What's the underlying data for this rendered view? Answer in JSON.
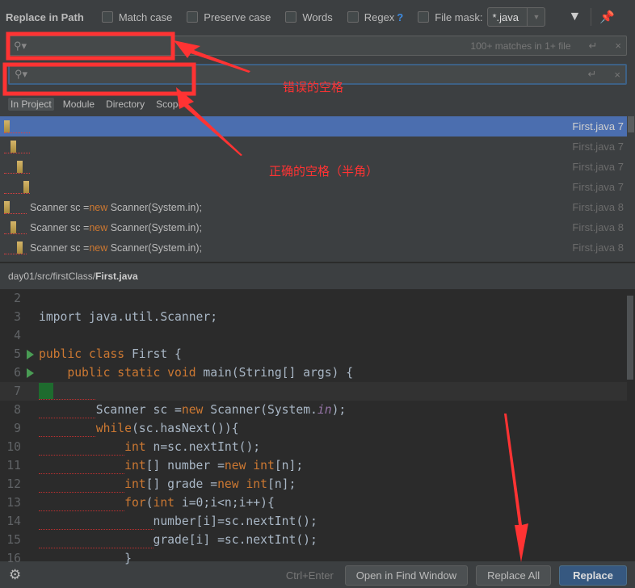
{
  "header": {
    "title": "Replace in Path",
    "options": [
      {
        "label": "Match case",
        "checked": false
      },
      {
        "label": "Preserve case",
        "checked": false
      },
      {
        "label": "Words",
        "checked": false
      },
      {
        "label": "Regex",
        "checked": false
      }
    ],
    "regex_help": "?",
    "file_mask_label": "File mask:",
    "file_mask_checked": false,
    "file_mask_value": "*.java"
  },
  "search": {
    "value": "",
    "match_info": "100+ matches in 1+ file"
  },
  "replace": {
    "value": ""
  },
  "scopes": [
    {
      "label": "In Project",
      "selected": true
    },
    {
      "label": "Module"
    },
    {
      "label": "Directory"
    },
    {
      "label": "Scope"
    }
  ],
  "results": [
    {
      "text": "",
      "file": "First.java 7",
      "selected": true
    },
    {
      "text": "",
      "file": "First.java 7"
    },
    {
      "text": "",
      "file": "First.java 7"
    },
    {
      "text": "",
      "file": "First.java 7"
    },
    {
      "pre": "Scanner sc =",
      "kw": "new",
      "post": " Scanner(System.in);",
      "file": "First.java 8"
    },
    {
      "pre": "Scanner sc =",
      "kw": "new",
      "post": " Scanner(System.in);",
      "file": "First.java 8"
    },
    {
      "pre": "Scanner sc =",
      "kw": "new",
      "post": " Scanner(System.in);",
      "file": "First.java 8"
    }
  ],
  "path": {
    "dir": "day01/src/firstClass/",
    "file": "First.java"
  },
  "code": [
    {
      "n": "2",
      "parts": []
    },
    {
      "n": "3",
      "parts": [
        [
          "import java.util.Scanner;",
          ""
        ]
      ]
    },
    {
      "n": "4",
      "parts": []
    },
    {
      "n": "5",
      "run": true,
      "parts": [
        [
          "public class ",
          "kw"
        ],
        [
          "First {",
          ""
        ]
      ]
    },
    {
      "n": "6",
      "run": true,
      "parts": [
        [
          "    public static void ",
          "kw"
        ],
        [
          "main(String[] args) {",
          ""
        ]
      ]
    },
    {
      "n": "7",
      "parts": [],
      "current": true
    },
    {
      "n": "8",
      "parts": [
        [
          "        Scanner sc =",
          ""
        ],
        [
          "new ",
          "kw"
        ],
        [
          "Scanner(System.",
          ""
        ],
        [
          "in",
          "cm"
        ],
        [
          ");",
          ""
        ]
      ]
    },
    {
      "n": "9",
      "parts": [
        [
          "        while",
          "kw"
        ],
        [
          "(sc.hasNext()){",
          ""
        ]
      ]
    },
    {
      "n": "10",
      "parts": [
        [
          "            int ",
          "kw"
        ],
        [
          "n=sc.nextInt();",
          ""
        ]
      ]
    },
    {
      "n": "11",
      "parts": [
        [
          "            int",
          "kw"
        ],
        [
          "[] number =",
          ""
        ],
        [
          "new int",
          "kw"
        ],
        [
          "[n];",
          ""
        ]
      ]
    },
    {
      "n": "12",
      "parts": [
        [
          "            int",
          "kw"
        ],
        [
          "[] grade =",
          ""
        ],
        [
          "new int",
          "kw"
        ],
        [
          "[n];",
          ""
        ]
      ]
    },
    {
      "n": "13",
      "parts": [
        [
          "            for",
          "kw"
        ],
        [
          "(",
          ""
        ],
        [
          "int ",
          "kw"
        ],
        [
          "i=0;i<n;i++){",
          ""
        ]
      ]
    },
    {
      "n": "14",
      "parts": [
        [
          "                number[i]=sc.nextInt();",
          ""
        ]
      ]
    },
    {
      "n": "15",
      "parts": [
        [
          "                grade[i] =sc.nextInt();",
          ""
        ]
      ]
    },
    {
      "n": "16",
      "parts": [
        [
          "            }",
          ""
        ]
      ]
    }
  ],
  "footer": {
    "shortcut": "Ctrl+Enter",
    "open_in_find_window": "Open in Find Window",
    "replace_all": "Replace All",
    "replace": "Replace"
  },
  "annotations": {
    "wrong_space": "错误的空格",
    "correct_space": "正确的空格（半角）"
  },
  "colors": {
    "accent": "#4b6eaf",
    "keyword": "#cc7832",
    "annotation": "#ff3333"
  }
}
